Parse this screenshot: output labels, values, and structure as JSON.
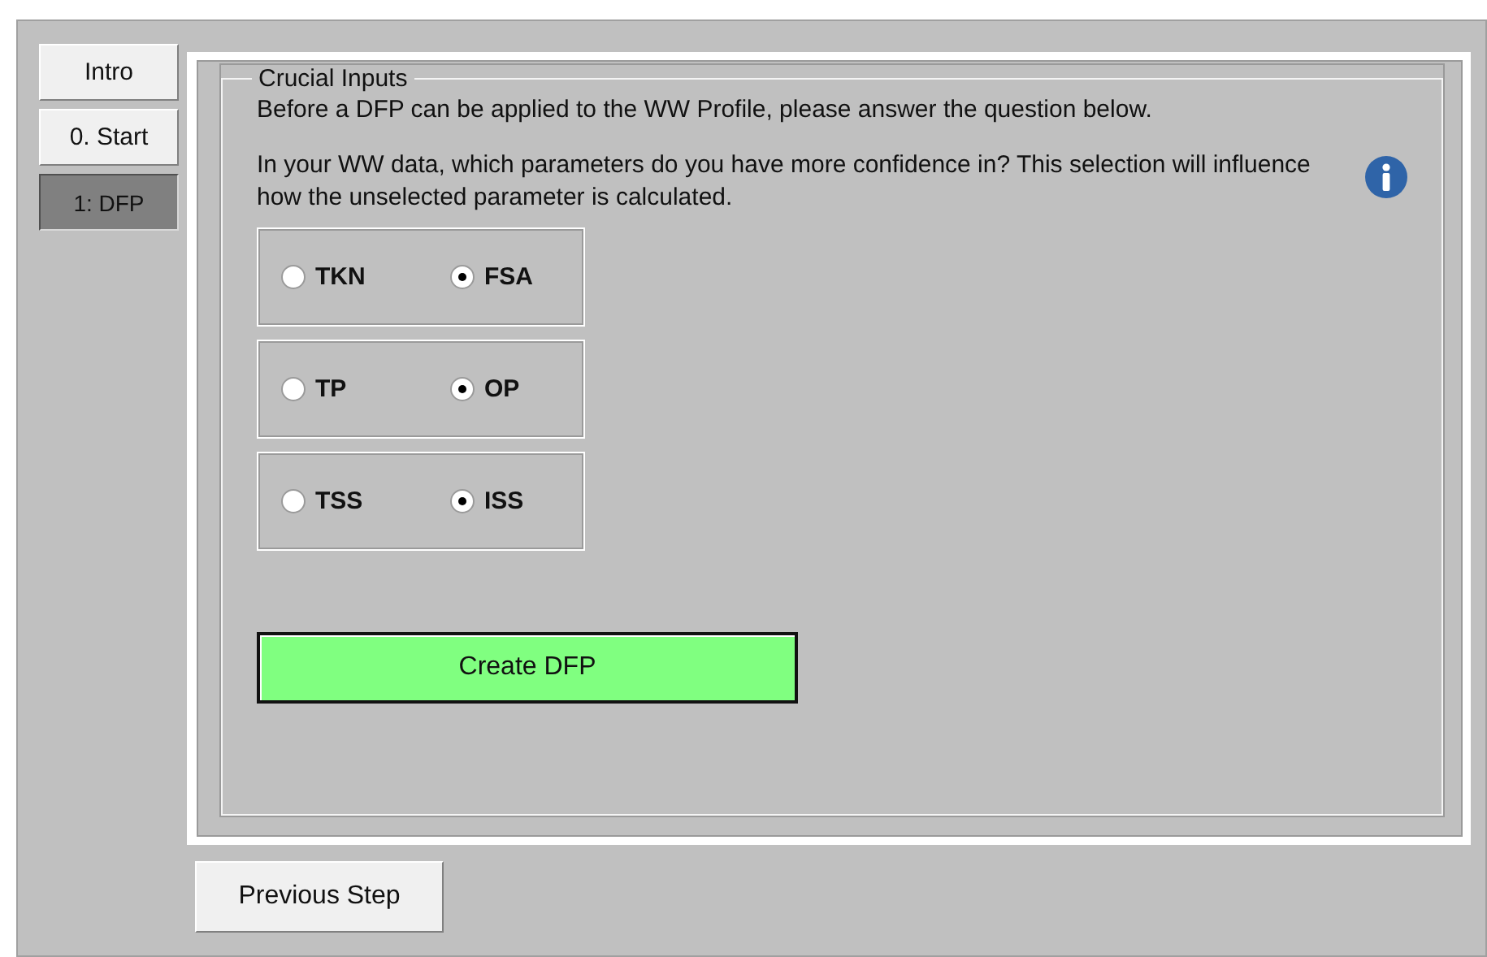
{
  "nav_tabs": [
    {
      "label": "Intro",
      "selected": false
    },
    {
      "label": "0. Start",
      "selected": false
    },
    {
      "label": "1: DFP",
      "selected": true
    }
  ],
  "group": {
    "title": "Crucial Inputs",
    "intro": "Before a DFP can be applied to the WW Profile, please answer the question below.",
    "question": "In your WW data, which parameters do you have more confidence in? This selection will influence how the unselected parameter is calculated.",
    "radio_groups": [
      {
        "options": [
          {
            "label": "TKN",
            "selected": false
          },
          {
            "label": "FSA",
            "selected": true
          }
        ]
      },
      {
        "options": [
          {
            "label": "TP",
            "selected": false
          },
          {
            "label": "OP",
            "selected": true
          }
        ]
      },
      {
        "options": [
          {
            "label": "TSS",
            "selected": false
          },
          {
            "label": "ISS",
            "selected": true
          }
        ]
      }
    ],
    "create_button": "Create DFP"
  },
  "previous_button": "Previous Step"
}
